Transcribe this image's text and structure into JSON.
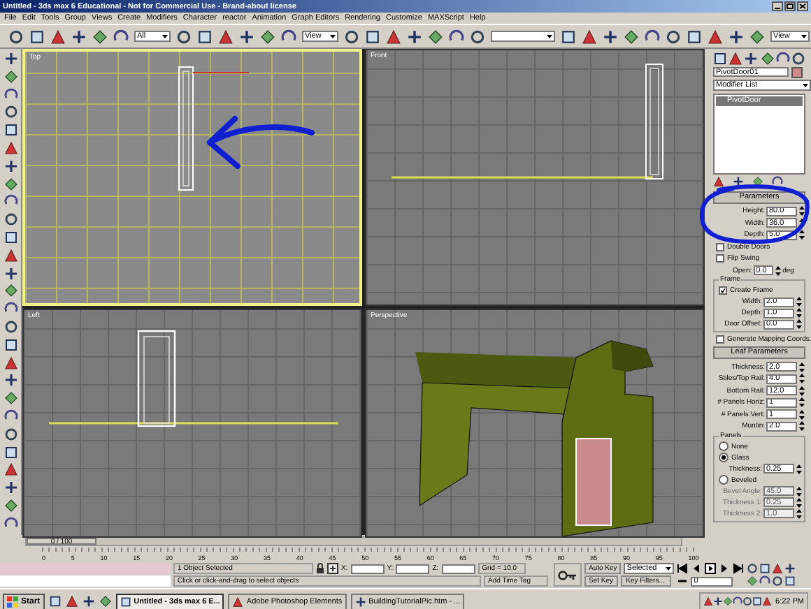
{
  "window": {
    "title": "Untitled - 3ds max 6 Educational - Not for Commercial Use - Brand-about license"
  },
  "menu": [
    "File",
    "Edit",
    "Tools",
    "Group",
    "Views",
    "Create",
    "Modifiers",
    "Character",
    "reactor",
    "Animation",
    "Graph Editors",
    "Rendering",
    "Customize",
    "MAXScript",
    "Help"
  ],
  "toolbar": {
    "selection_filter": "All",
    "reference_coord": "View",
    "render_type": "View"
  },
  "viewports": [
    {
      "label": "Top",
      "kind": "top",
      "active": true
    },
    {
      "label": "Front",
      "kind": "front",
      "active": false
    },
    {
      "label": "Left",
      "kind": "left",
      "active": false
    },
    {
      "label": "Perspective",
      "kind": "perspective",
      "active": false
    }
  ],
  "command_panel": {
    "object_name": "PivotDoor01",
    "modifier_list": "Modifier List",
    "stack": [
      {
        "label": "PivotDoor",
        "selected": true
      }
    ],
    "parameters": {
      "title": "Parameters",
      "spinners": [
        {
          "label": "Height:",
          "value": "80.0"
        },
        {
          "label": "Width:",
          "value": "36.0"
        },
        {
          "label": "Depth:",
          "value": "5.0"
        }
      ],
      "options": [
        {
          "label": "Double Doors",
          "checked": false
        },
        {
          "label": "Flip Swing",
          "checked": false
        }
      ],
      "open": {
        "label": "Open:",
        "value": "0.0",
        "unit": "deg"
      }
    },
    "frame": {
      "title": "Frame",
      "create_frame": {
        "label": "Create Frame",
        "checked": true
      },
      "spinners": [
        {
          "label": "Width:",
          "value": "2.0"
        },
        {
          "label": "Depth:",
          "value": "1.0"
        },
        {
          "label": "Door Offset:",
          "value": "0.0"
        }
      ]
    },
    "generate_mapping": {
      "label": "Generate Mapping Coords.",
      "checked": false
    },
    "leaf": {
      "title": "Leaf Parameters",
      "spinners": [
        {
          "label": "Thickness:",
          "value": "2.0"
        },
        {
          "label": "Stiles/Top Rail:",
          "value": "4.0"
        },
        {
          "label": "Bottom Rail:",
          "value": "12.0"
        },
        {
          "label": "# Panels Horiz:",
          "value": "1"
        },
        {
          "label": "# Panels Vert:",
          "value": "1"
        },
        {
          "label": "Muntin:",
          "value": "2.0"
        }
      ]
    },
    "panels": {
      "title": "Panels",
      "options": [
        {
          "label": "None",
          "selected": false
        },
        {
          "label": "Glass",
          "selected": true
        }
      ],
      "glass_thickness": {
        "label": "Thickness:",
        "value": "0.25"
      },
      "beveled": {
        "label": "Beveled",
        "selected": false
      },
      "bevel_spinners": [
        {
          "label": "Bevel Angle:",
          "value": "45.0",
          "disabled": true
        },
        {
          "label": "Thickness 1:",
          "value": "0.25",
          "disabled": true
        },
        {
          "label": "Thickness 2:",
          "value": "1.0",
          "disabled": true
        }
      ]
    }
  },
  "time_slider": {
    "label": "0 / 100",
    "level": 0
  },
  "track_ticks": [
    "0",
    "5",
    "10",
    "15",
    "20",
    "25",
    "30",
    "35",
    "40",
    "45",
    "50",
    "55",
    "60",
    "65",
    "70",
    "75",
    "80",
    "85",
    "90",
    "95",
    "100"
  ],
  "status": {
    "selection": "1 Object Selected",
    "prompt": "Click or click-and-drag to select objects",
    "coords": [
      {
        "axis": "X:"
      },
      {
        "axis": "Y:"
      },
      {
        "axis": "Z:"
      }
    ],
    "grid": "Grid = 10.0",
    "time_tag": "Add Time Tag",
    "auto_key": "Auto Key",
    "key_mode": "Selected",
    "set_key": "Set Key",
    "key_filters": "Key Filters...",
    "frame": "0"
  },
  "taskbar": {
    "start": "Start",
    "tasks": [
      {
        "label": "Untitled - 3ds max 6 E...",
        "selected": true
      },
      {
        "label": "Adobe Photoshop Elements",
        "selected": false
      },
      {
        "label": "BuildingTutorialPic.htm - ...",
        "selected": false
      }
    ],
    "clock": "6:22 PM"
  }
}
